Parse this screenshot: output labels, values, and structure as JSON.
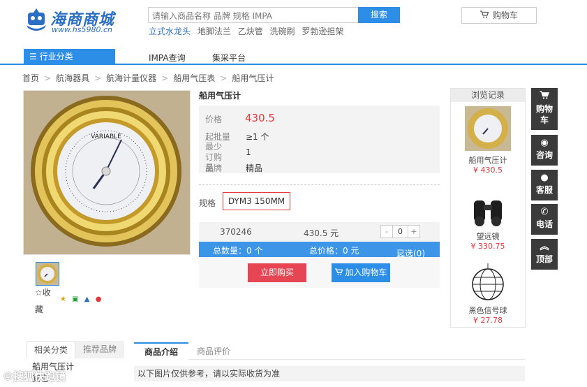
{
  "brand": {
    "name": "海商商城",
    "url": "www.hs5980.cn"
  },
  "search": {
    "placeholder": "请输入商品名称 品牌 规格 IMPA",
    "button": "搜索"
  },
  "hot_words": [
    "立式水龙头",
    "地脚法兰",
    "乙炔管",
    "洗碗刷",
    "罗勃逊担架"
  ],
  "cart_top": {
    "label": "购物车"
  },
  "nav": {
    "category": "行业分类",
    "items": [
      "IMPA查询",
      "集采平台"
    ]
  },
  "breadcrumb": [
    "首页",
    "航海器具",
    "航海计量仪器",
    "船用气压表",
    "船用气压计"
  ],
  "product": {
    "title": "船用气压计",
    "price_label": "价格",
    "price": "430.5",
    "min_batch_label": "起批量",
    "min_batch": "≥1 个",
    "min_order_label": "最少订购量",
    "min_order": "1",
    "brand_label": "品牌",
    "brand": "精品",
    "spec_label": "规格",
    "spec": "DYM3 150MM",
    "favorite_1": "☆收",
    "favorite_2": "藏"
  },
  "order": {
    "code": "370246",
    "unit_price": "430.5 元",
    "qty": "0",
    "minus": "-",
    "plus": "+",
    "total_qty": "总数量：0 个",
    "total_price": "总价格：0 元",
    "selected": "已选(0)"
  },
  "actions": {
    "buy_now": "立即购买",
    "add_cart": "加入购物车"
  },
  "history": {
    "title": "浏览记录",
    "items": [
      {
        "name": "船用气压计",
        "price": "¥ 430.5"
      },
      {
        "name": "望远镜",
        "price": "¥ 330.75"
      },
      {
        "name": "黑色信号球",
        "price": "¥ 27.78"
      }
    ]
  },
  "tools": [
    {
      "label": "购物车",
      "icon": "cart-icon"
    },
    {
      "label": "咨询",
      "icon": "chat-icon"
    },
    {
      "label": "客服",
      "icon": "service-icon"
    },
    {
      "label": "电话",
      "icon": "phone-icon"
    },
    {
      "label": "顶部",
      "icon": "top-icon"
    }
  ],
  "bottom": {
    "related_tab": "相关分类",
    "recommend_tab": "推荐品牌",
    "related_items": [
      "船用气压计",
      "其它"
    ],
    "desc_tab": "商品介绍",
    "review_tab": "商品评价",
    "desc_note": "以下图片仅供参考，请以实际收货为准"
  },
  "watermark": "©搜狐快跑镜",
  "colors": {
    "accent": "#2d8ee8",
    "price": "#e4393c",
    "buy": "#e64553"
  }
}
